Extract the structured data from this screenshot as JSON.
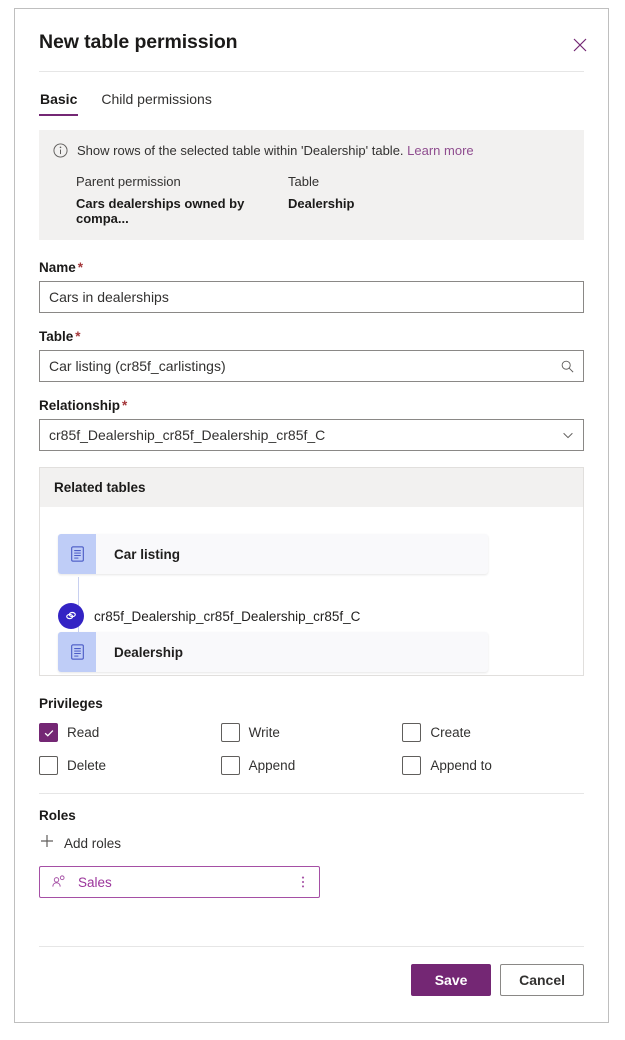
{
  "dialog": {
    "title": "New table permission",
    "close_icon": "close-icon"
  },
  "tabs": [
    {
      "label": "Basic",
      "active": true
    },
    {
      "label": "Child permissions",
      "active": false
    }
  ],
  "info_banner": {
    "icon": "info-icon",
    "message": "Show rows of the selected table within 'Dealership' table.",
    "link_label": "Learn more",
    "columns": [
      {
        "header": "Parent permission",
        "value": "Cars dealerships owned by compa..."
      },
      {
        "header": "Table",
        "value": "Dealership"
      }
    ]
  },
  "fields": {
    "name": {
      "label": "Name",
      "required_marker": "*",
      "value": "Cars in dealerships",
      "placeholder": ""
    },
    "table": {
      "label": "Table",
      "required_marker": "*",
      "value": "Car listing (cr85f_carlistings)",
      "placeholder": "",
      "adorn_icon": "search-icon"
    },
    "relationship": {
      "label": "Relationship",
      "required_marker": "*",
      "value": "cr85f_Dealership_cr85f_Dealership_cr85f_C",
      "placeholder": "",
      "adorn_icon": "chevron-down-icon"
    }
  },
  "related_tables": {
    "header": "Related tables",
    "top_entity": {
      "name": "Car listing",
      "icon": "table-icon",
      "stacked": true
    },
    "relationship_label": "cr85f_Dealership_cr85f_Dealership_cr85f_C",
    "relationship_icon": "link-icon",
    "bottom_entity": {
      "name": "Dealership",
      "icon": "table-icon",
      "stacked": false
    }
  },
  "privileges": {
    "label": "Privileges",
    "items": [
      {
        "label": "Read",
        "checked": true
      },
      {
        "label": "Write",
        "checked": false
      },
      {
        "label": "Create",
        "checked": false
      },
      {
        "label": "Delete",
        "checked": false
      },
      {
        "label": "Append",
        "checked": false
      },
      {
        "label": "Append to",
        "checked": false
      }
    ]
  },
  "roles": {
    "label": "Roles",
    "add_label": "Add roles",
    "add_icon": "plus-icon",
    "chips": [
      {
        "label": "Sales",
        "icon": "person-role-icon",
        "more_icon": "more-vertical-icon"
      }
    ]
  },
  "footer": {
    "save_label": "Save",
    "cancel_label": "Cancel"
  },
  "colors": {
    "accent": "#742774",
    "link": "#8f4d8f",
    "required": "#a4373a",
    "banner_bg": "#f2f1f0",
    "entity_icon_bg": "#bfcdf7",
    "link_badge_bg": "#3323c4",
    "chip_border": "#a54fa5"
  }
}
